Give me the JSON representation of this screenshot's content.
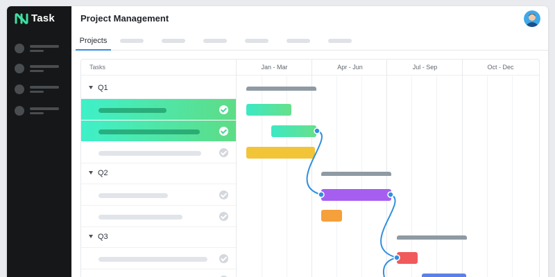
{
  "app": {
    "name": "Task"
  },
  "header": {
    "title": "Project Management"
  },
  "tabs": {
    "active_label": "Projects"
  },
  "gantt": {
    "tasks_header": "Tasks",
    "quarters": [
      "Jan - Mar",
      "Apr - Jun",
      "Jul - Sep",
      "Oct - Dec"
    ],
    "groups": [
      "Q1",
      "Q2",
      "Q3"
    ]
  },
  "colors": {
    "sidebar": "#151718",
    "accent": "#2f8fe0",
    "completed_row": "#45d79f",
    "bar_teal": "#5ae0b6",
    "bar_yellow": "#f2c438",
    "bar_purple": "#a65ef0",
    "bar_orange": "#f5a03a",
    "bar_red": "#f15a5a",
    "bar_blue": "#5b80e6",
    "summary_bar": "#8f9aa3"
  },
  "icons": [
    "logo-icon",
    "avatar-icon",
    "caret-down-icon",
    "check-circle-icon"
  ]
}
